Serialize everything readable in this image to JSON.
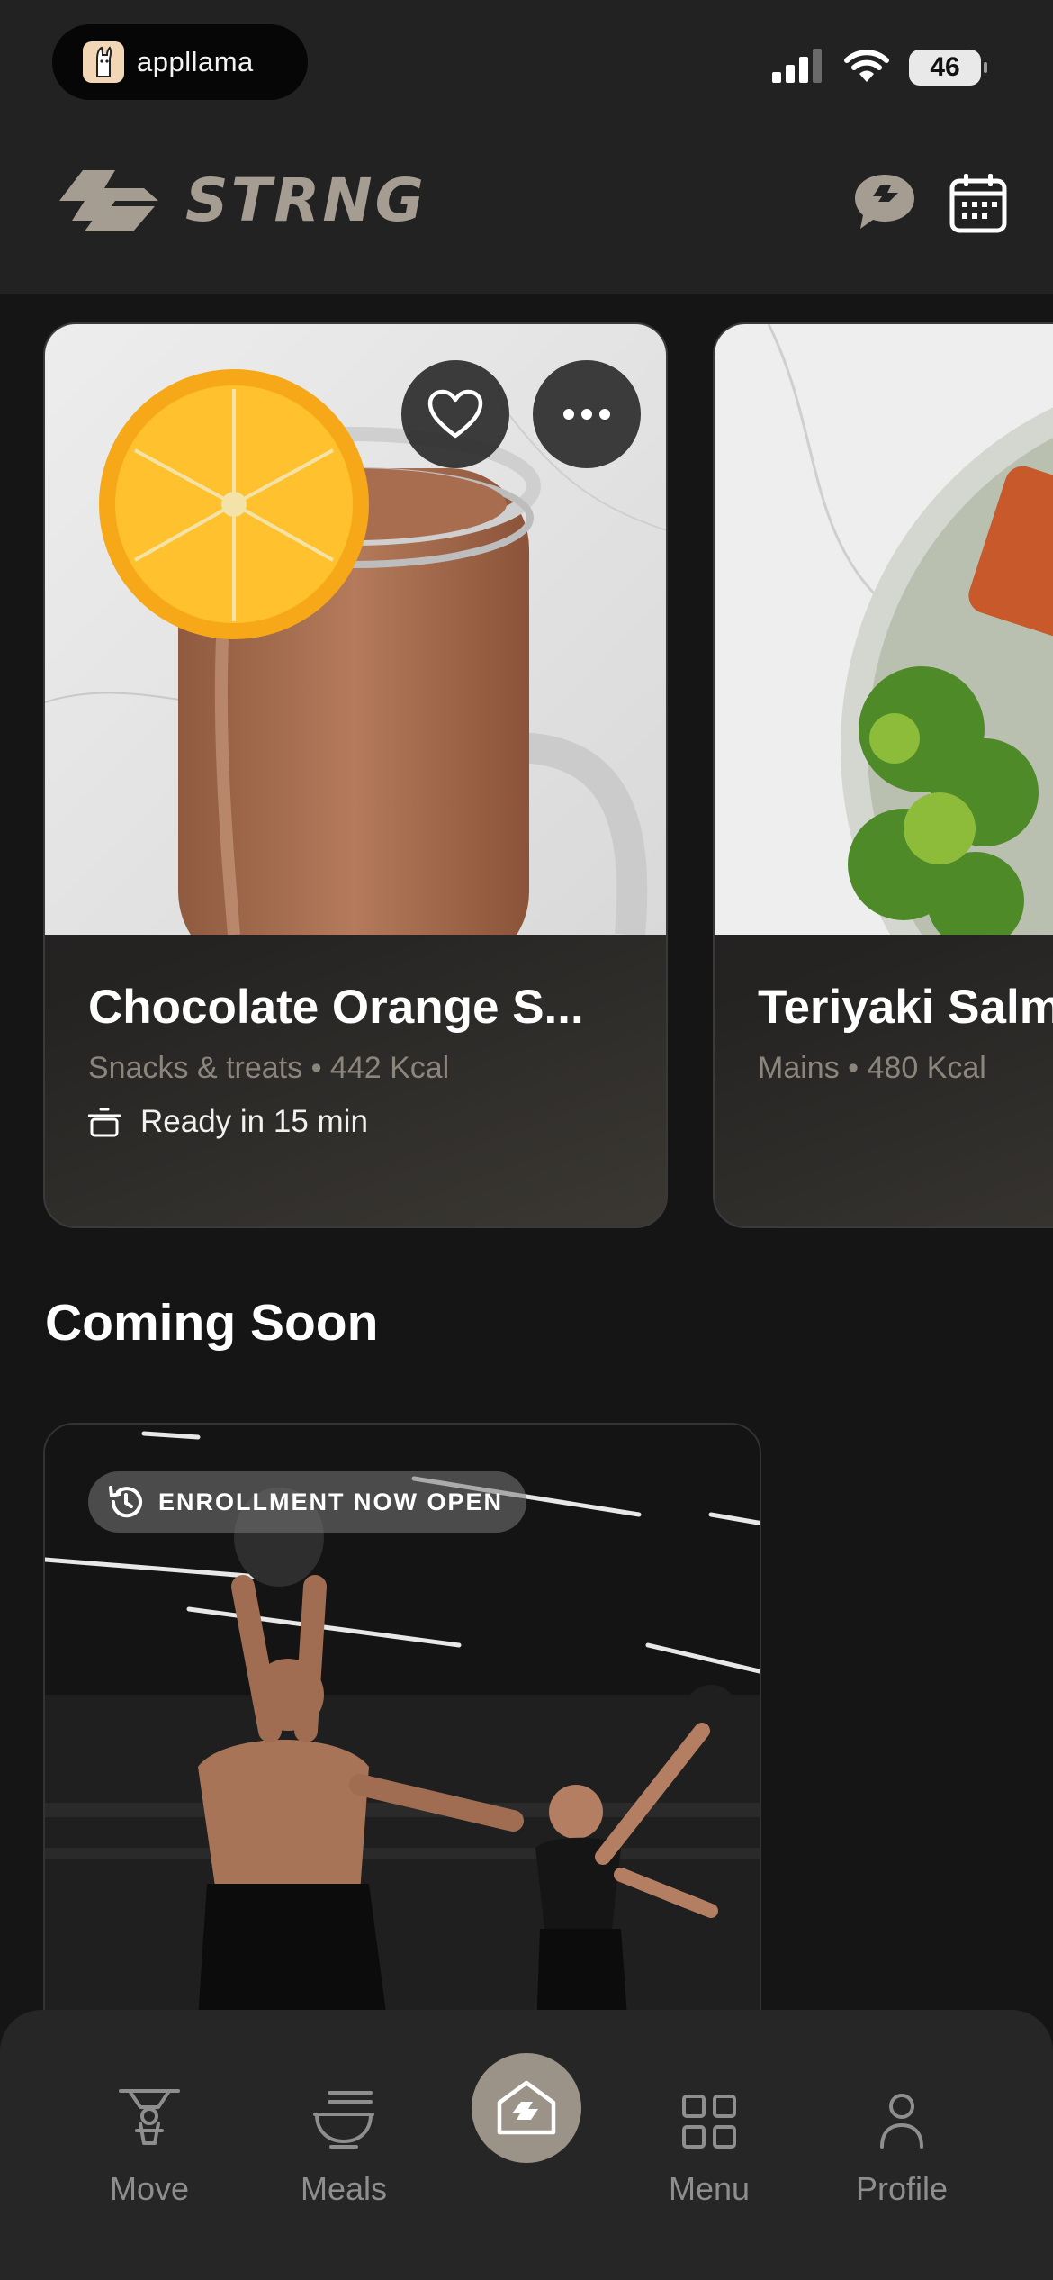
{
  "status_bar": {
    "app_name": "appllama",
    "battery": "46"
  },
  "header": {
    "brand": "STRNG"
  },
  "meals": [
    {
      "title": "Chocolate Orange S...",
      "category": "Snacks & treats",
      "kcal": "442 Kcal",
      "ready": "Ready in 15 min"
    },
    {
      "title": "Teriyaki Salm",
      "category": "Mains",
      "kcal": "480 Kcal"
    }
  ],
  "meta_separator": "•",
  "coming_soon": {
    "title": "Coming Soon",
    "badge": "ENROLLMENT NOW OPEN"
  },
  "nav": {
    "items": [
      {
        "label": "Move",
        "icon": "kettlebell-person-icon"
      },
      {
        "label": "Meals",
        "icon": "noodle-bowl-icon"
      },
      {
        "label": "",
        "icon": "strng-home-icon"
      },
      {
        "label": "Menu",
        "icon": "grid-icon"
      },
      {
        "label": "Profile",
        "icon": "person-icon"
      }
    ]
  },
  "colors": {
    "background": "#151515",
    "header": "#222222",
    "brand": "#a59d91",
    "accent": "#9c9388",
    "muted_text": "#8c857c"
  }
}
